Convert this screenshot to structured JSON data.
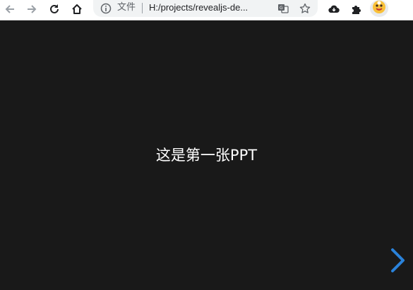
{
  "browser": {
    "security_label": "文件",
    "url": "H:/projects/revealjs-de...",
    "buttons": {
      "back": "arrow-left-icon",
      "forward": "arrow-right-icon",
      "reload": "reload-icon",
      "home": "home-icon",
      "info": "info-icon",
      "translate": "translate-icon",
      "bookmark": "star-icon",
      "download": "cloud-download-icon",
      "extensions": "puzzle-icon",
      "profile": "avatar-icon"
    }
  },
  "slide": {
    "title": "这是第一张PPT",
    "controls": {
      "next": "chevron-right-icon",
      "next_color": "#2a82da"
    }
  },
  "colors": {
    "slide_background": "#191919",
    "slide_text": "#ffffff",
    "toolbar_background": "#ffffff",
    "omnibox_background": "#f1f3f4"
  }
}
